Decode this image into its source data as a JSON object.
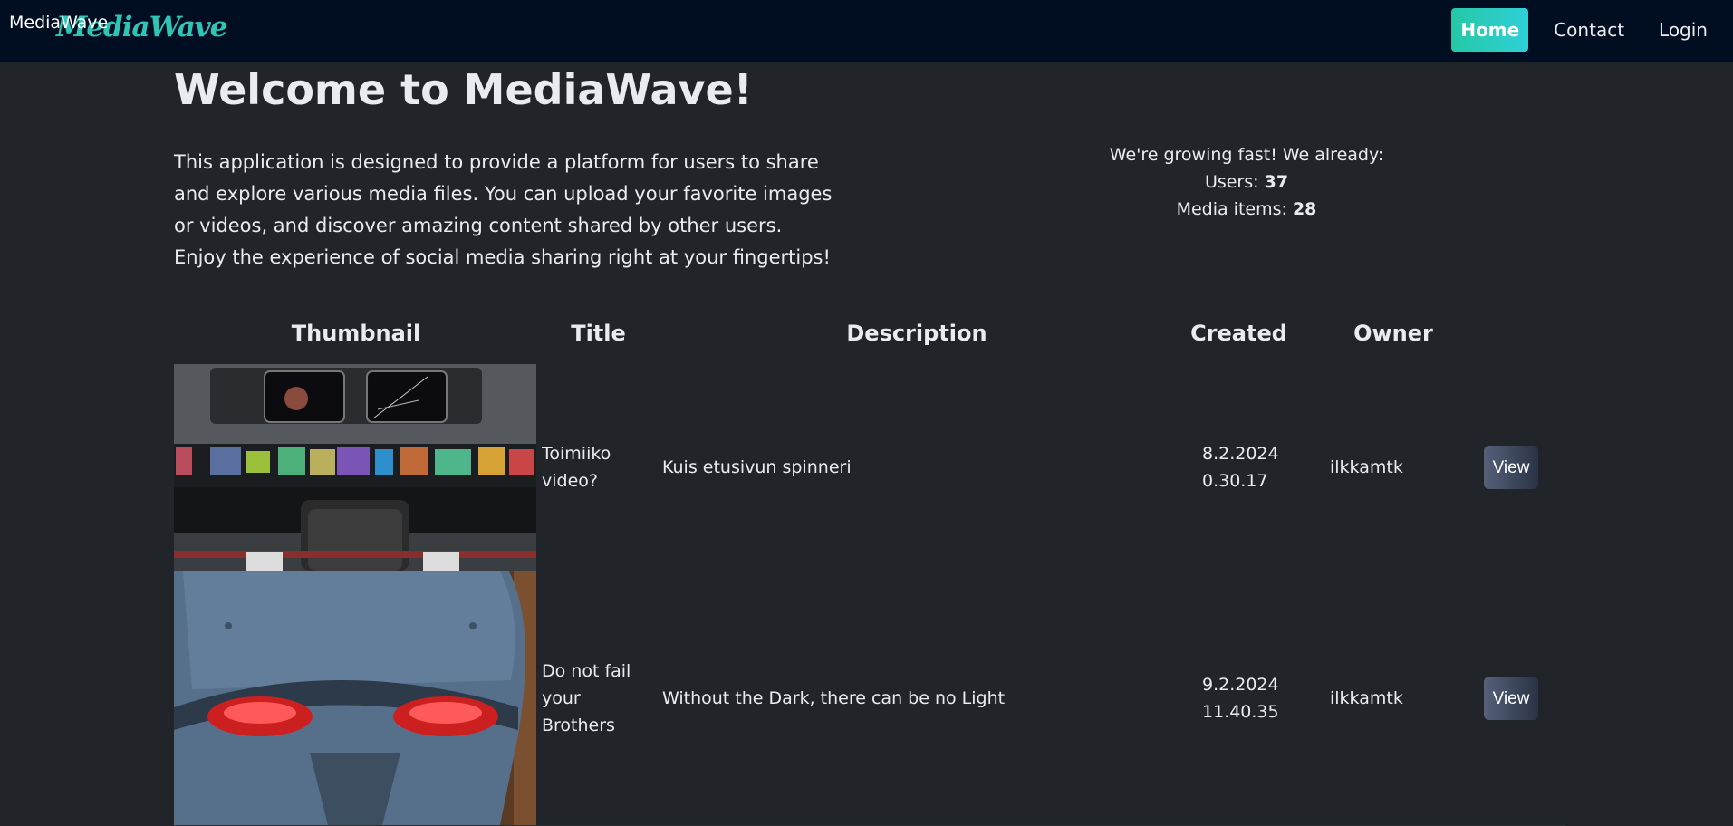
{
  "navbar": {
    "brand_text": "MediaWave",
    "brand_logo": "MediaWave",
    "links": [
      {
        "label": "Home",
        "active": true
      },
      {
        "label": "Contact",
        "active": false
      },
      {
        "label": "Login",
        "active": false
      }
    ]
  },
  "hero": {
    "title": "Welcome to MediaWave!",
    "description": "This application is designed to provide a platform for users to share and explore various media files. You can upload your favorite images or videos, and discover amazing content shared by other users. Enjoy the experience of social media sharing right at your fingertips!"
  },
  "stats": {
    "heading": "We're growing fast! We already:",
    "users_label": "Users: ",
    "users_count": "37",
    "media_label": "Media items: ",
    "media_count": "28"
  },
  "table": {
    "headers": [
      "Thumbnail",
      "Title",
      "Description",
      "Created",
      "Owner",
      ""
    ],
    "rows": [
      {
        "thumbnail": "starship-bridge-image",
        "title": "Toimiiko video?",
        "description": "Kuis etusivun spinneri",
        "created_date": "8.2.2024",
        "created_time": "0.30.17",
        "owner": "ilkkamtk",
        "action": "View"
      },
      {
        "thumbnail": "armored-helmet-image",
        "title": "Do not fail your Brothers",
        "description": "Without the Dark, there can be no Light",
        "created_date": "9.2.2024",
        "created_time": "11.40.35",
        "owner": "ilkkamtk",
        "action": "View"
      }
    ]
  },
  "colors": {
    "background": "#212529",
    "navbar": "#010e21",
    "accent": "#2ec4b6"
  }
}
